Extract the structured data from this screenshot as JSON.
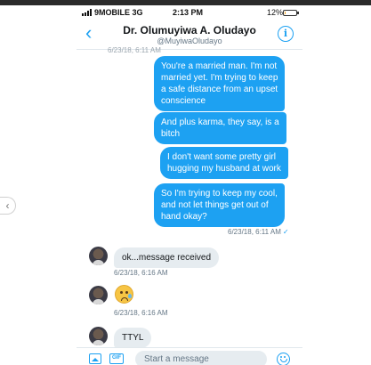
{
  "status_bar": {
    "carrier": "9MOBILE  3G",
    "time": "2:13 PM",
    "battery": "12%",
    "battery_level": 0.12
  },
  "header": {
    "back_icon": "chevron-left-icon",
    "name": "Dr. Olumuyiwa A. Oludayo",
    "handle": "@MuyiwaOludayo",
    "info_icon": "info-icon"
  },
  "thread": {
    "cut_timestamp": "6/23/18, 6:11 AM",
    "outgoing": [
      "You're a married man. I'm not married yet. I'm trying to keep a safe distance from an upset conscience",
      "And plus karma, they say, is a bitch",
      "I don't want some pretty girl hugging my husband at work",
      "So I'm trying to keep my cool, and not let things get out of hand okay?"
    ],
    "outgoing_lines": [
      [
        "You're a married man. I'm not",
        "married yet. I'm trying to keep",
        "a safe distance from an upset",
        "conscience"
      ],
      [
        "And plus karma, they say, is a",
        "bitch"
      ],
      [
        "I don't want some pretty girl",
        "hugging my husband at work"
      ],
      [
        "So I'm trying to keep my cool,",
        "and not let things get out of",
        "hand okay?"
      ]
    ],
    "outgoing_time": "6/23/18, 6:11 AM",
    "outgoing_check": "✓",
    "incoming": [
      {
        "text": "ok...message received",
        "time": "6/23/18, 6:16 AM"
      },
      {
        "emoji": "crying-face-emoji",
        "time": "6/23/18, 6:16 AM"
      },
      {
        "text": "TTYL"
      }
    ]
  },
  "composer": {
    "image_icon": "image-icon",
    "gif_label": "GIF",
    "placeholder": "Start a message",
    "emoji_icon": "smiley-icon"
  },
  "colors": {
    "accent": "#1da1f2",
    "incoming_bubble": "#e6ecf0",
    "text": "#14171a",
    "muted": "#657786"
  }
}
